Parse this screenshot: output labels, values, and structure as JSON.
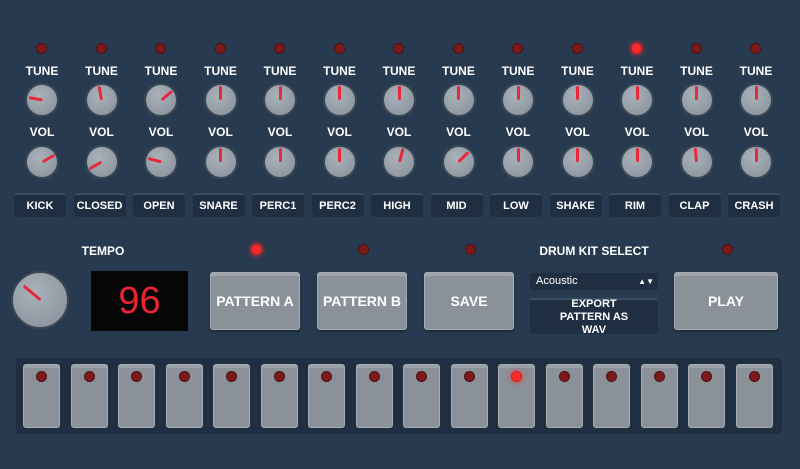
{
  "channels": [
    {
      "name": "KICK",
      "tune_label": "TUNE",
      "vol_label": "VOL",
      "tune_angle": -80,
      "vol_angle": 60,
      "led_on": false
    },
    {
      "name": "CLOSED",
      "tune_label": "TUNE",
      "vol_label": "VOL",
      "tune_angle": -10,
      "vol_angle": -120,
      "led_on": false
    },
    {
      "name": "OPEN",
      "tune_label": "TUNE",
      "vol_label": "VOL",
      "tune_angle": 50,
      "vol_angle": -75,
      "led_on": false
    },
    {
      "name": "SNARE",
      "tune_label": "TUNE",
      "vol_label": "VOL",
      "tune_angle": 0,
      "vol_angle": 0,
      "led_on": false
    },
    {
      "name": "PERC1",
      "tune_label": "TUNE",
      "vol_label": "VOL",
      "tune_angle": 0,
      "vol_angle": 0,
      "led_on": false
    },
    {
      "name": "PERC2",
      "tune_label": "TUNE",
      "vol_label": "VOL",
      "tune_angle": 0,
      "vol_angle": 0,
      "led_on": false
    },
    {
      "name": "HIGH",
      "tune_label": "TUNE",
      "vol_label": "VOL",
      "tune_angle": 0,
      "vol_angle": 15,
      "led_on": false
    },
    {
      "name": "MID",
      "tune_label": "TUNE",
      "vol_label": "VOL",
      "tune_angle": 0,
      "vol_angle": 45,
      "led_on": false
    },
    {
      "name": "LOW",
      "tune_label": "TUNE",
      "vol_label": "VOL",
      "tune_angle": 0,
      "vol_angle": 0,
      "led_on": false
    },
    {
      "name": "SHAKE",
      "tune_label": "TUNE",
      "vol_label": "VOL",
      "tune_angle": 0,
      "vol_angle": 0,
      "led_on": false
    },
    {
      "name": "RIM",
      "tune_label": "TUNE",
      "vol_label": "VOL",
      "tune_angle": 0,
      "vol_angle": 0,
      "led_on": true
    },
    {
      "name": "CLAP",
      "tune_label": "TUNE",
      "vol_label": "VOL",
      "tune_angle": 0,
      "vol_angle": -5,
      "led_on": false
    },
    {
      "name": "CRASH",
      "tune_label": "TUNE",
      "vol_label": "VOL",
      "tune_angle": 0,
      "vol_angle": 0,
      "led_on": false
    }
  ],
  "tempo": {
    "label": "TEMPO",
    "value": "96",
    "knob_angle": -50
  },
  "pattern_a": {
    "label": "PATTERN A",
    "led_on": true
  },
  "pattern_b": {
    "label": "PATTERN B",
    "led_on": false
  },
  "save": {
    "label": "SAVE",
    "led_on": false
  },
  "drum_kit": {
    "label": "DRUM KIT SELECT",
    "selected": "Acoustic",
    "arrow": "▲▼"
  },
  "export": {
    "label": "EXPORT PATTERN AS WAV"
  },
  "play": {
    "label": "PLAY",
    "led_on": false
  },
  "steps": [
    false,
    false,
    false,
    false,
    false,
    false,
    false,
    false,
    false,
    false,
    true,
    false,
    false,
    false,
    false,
    false
  ],
  "colors": {
    "led_on": "#ff2a2a",
    "led_off": "#7a1a1a",
    "display_text": "#ee2233",
    "background": "#273a4f"
  }
}
